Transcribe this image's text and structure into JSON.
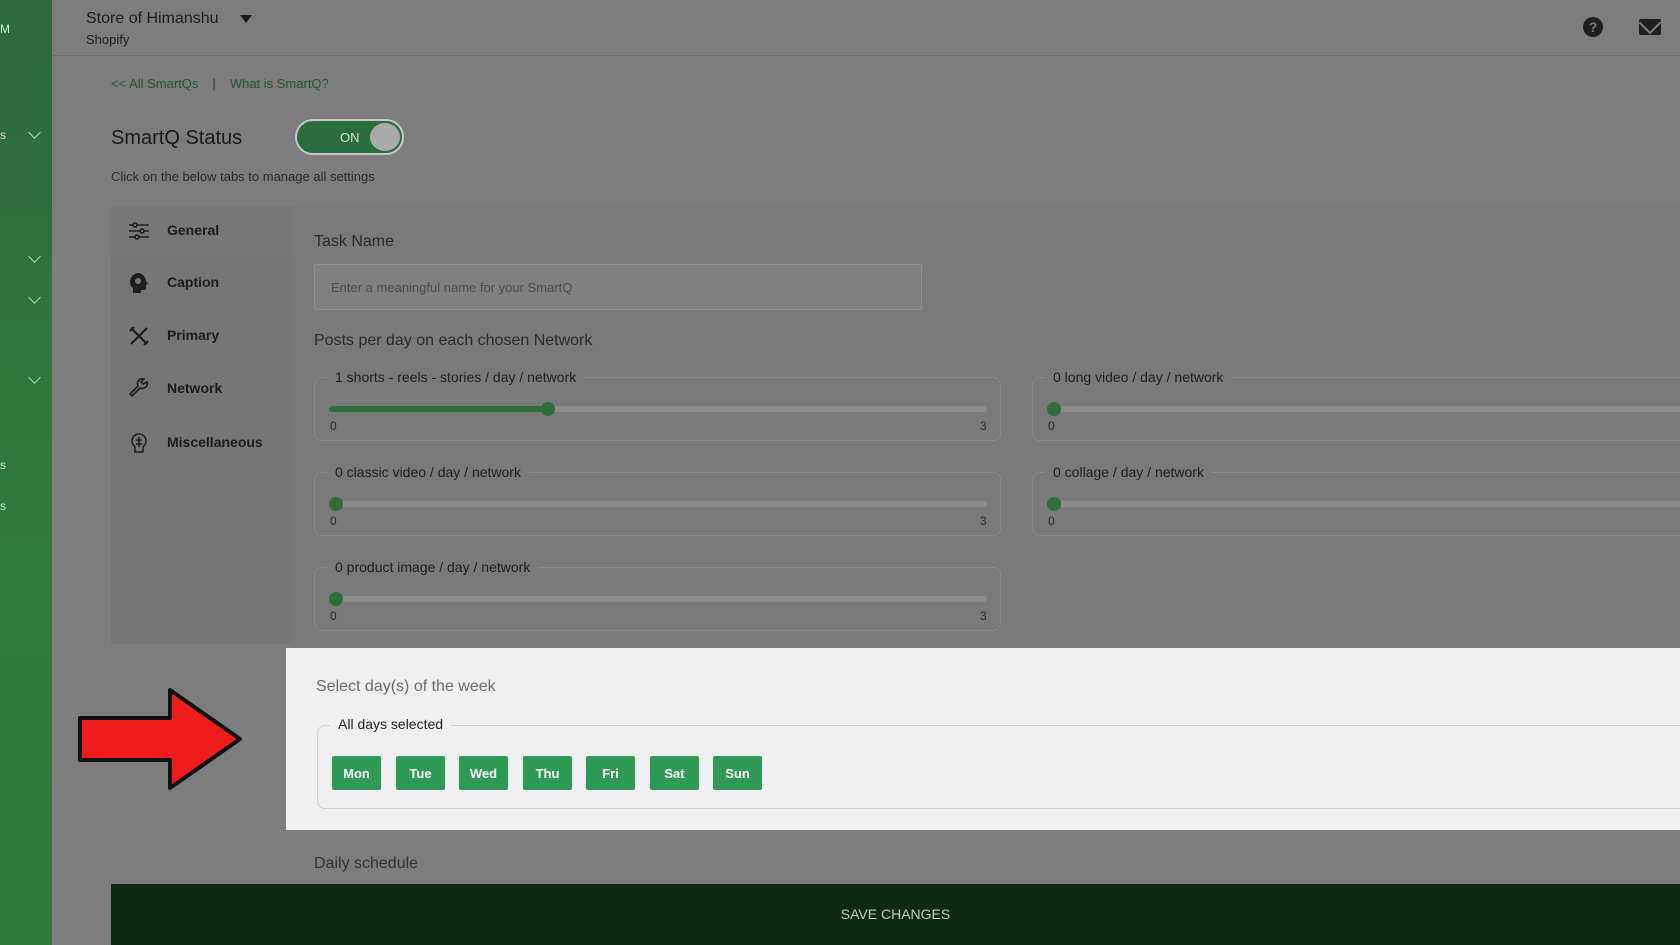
{
  "header": {
    "store_name": "Store of Himanshu",
    "platform": "Shopify",
    "help_icon": "help-circle-icon",
    "mail_icon": "mail-icon"
  },
  "rail": {
    "fragments": [
      "M",
      "s",
      "s",
      "s"
    ]
  },
  "links": {
    "all_smartqs": "<< All SmartQs",
    "separator": "|",
    "what_is": "What is SmartQ?"
  },
  "status": {
    "label": "SmartQ Status",
    "toggle": "ON",
    "hint": "Click on the below tabs to manage all settings"
  },
  "tabs": [
    {
      "label": "General",
      "icon": "sliders-icon"
    },
    {
      "label": "Caption",
      "icon": "head-icon"
    },
    {
      "label": "Primary",
      "icon": "tools-icon"
    },
    {
      "label": "Network",
      "icon": "wrench-icon"
    },
    {
      "label": "Miscellaneous",
      "icon": "brain-icon"
    }
  ],
  "task": {
    "label": "Task Name",
    "placeholder": "Enter a meaningful name for your SmartQ"
  },
  "posts": {
    "label": "Posts per day on each chosen Network",
    "sliders": [
      {
        "label": "1 shorts - reels - stories / day / network",
        "value": 1,
        "min": "0",
        "max": "3"
      },
      {
        "label": "0 long video / day / network",
        "value": 0,
        "min": "0",
        "max": ""
      },
      {
        "label": "0 classic video / day / network",
        "value": 0,
        "min": "0",
        "max": "3"
      },
      {
        "label": "0 collage / day / network",
        "value": 0,
        "min": "0",
        "max": ""
      },
      {
        "label": "0 product image / day / network",
        "value": 0,
        "min": "0",
        "max": "3"
      }
    ]
  },
  "days": {
    "title": "Select day(s) of the week",
    "legend": "All days selected",
    "items": [
      "Mon",
      "Tue",
      "Wed",
      "Thu",
      "Fri",
      "Sat",
      "Sun"
    ],
    "button_color": "#2e9a55"
  },
  "schedule": {
    "label": "Daily schedule"
  },
  "save": {
    "label": "SAVE CHANGES"
  },
  "colors": {
    "brand_green": "#2f7a3f",
    "arrow_red": "#ee1c1c"
  }
}
